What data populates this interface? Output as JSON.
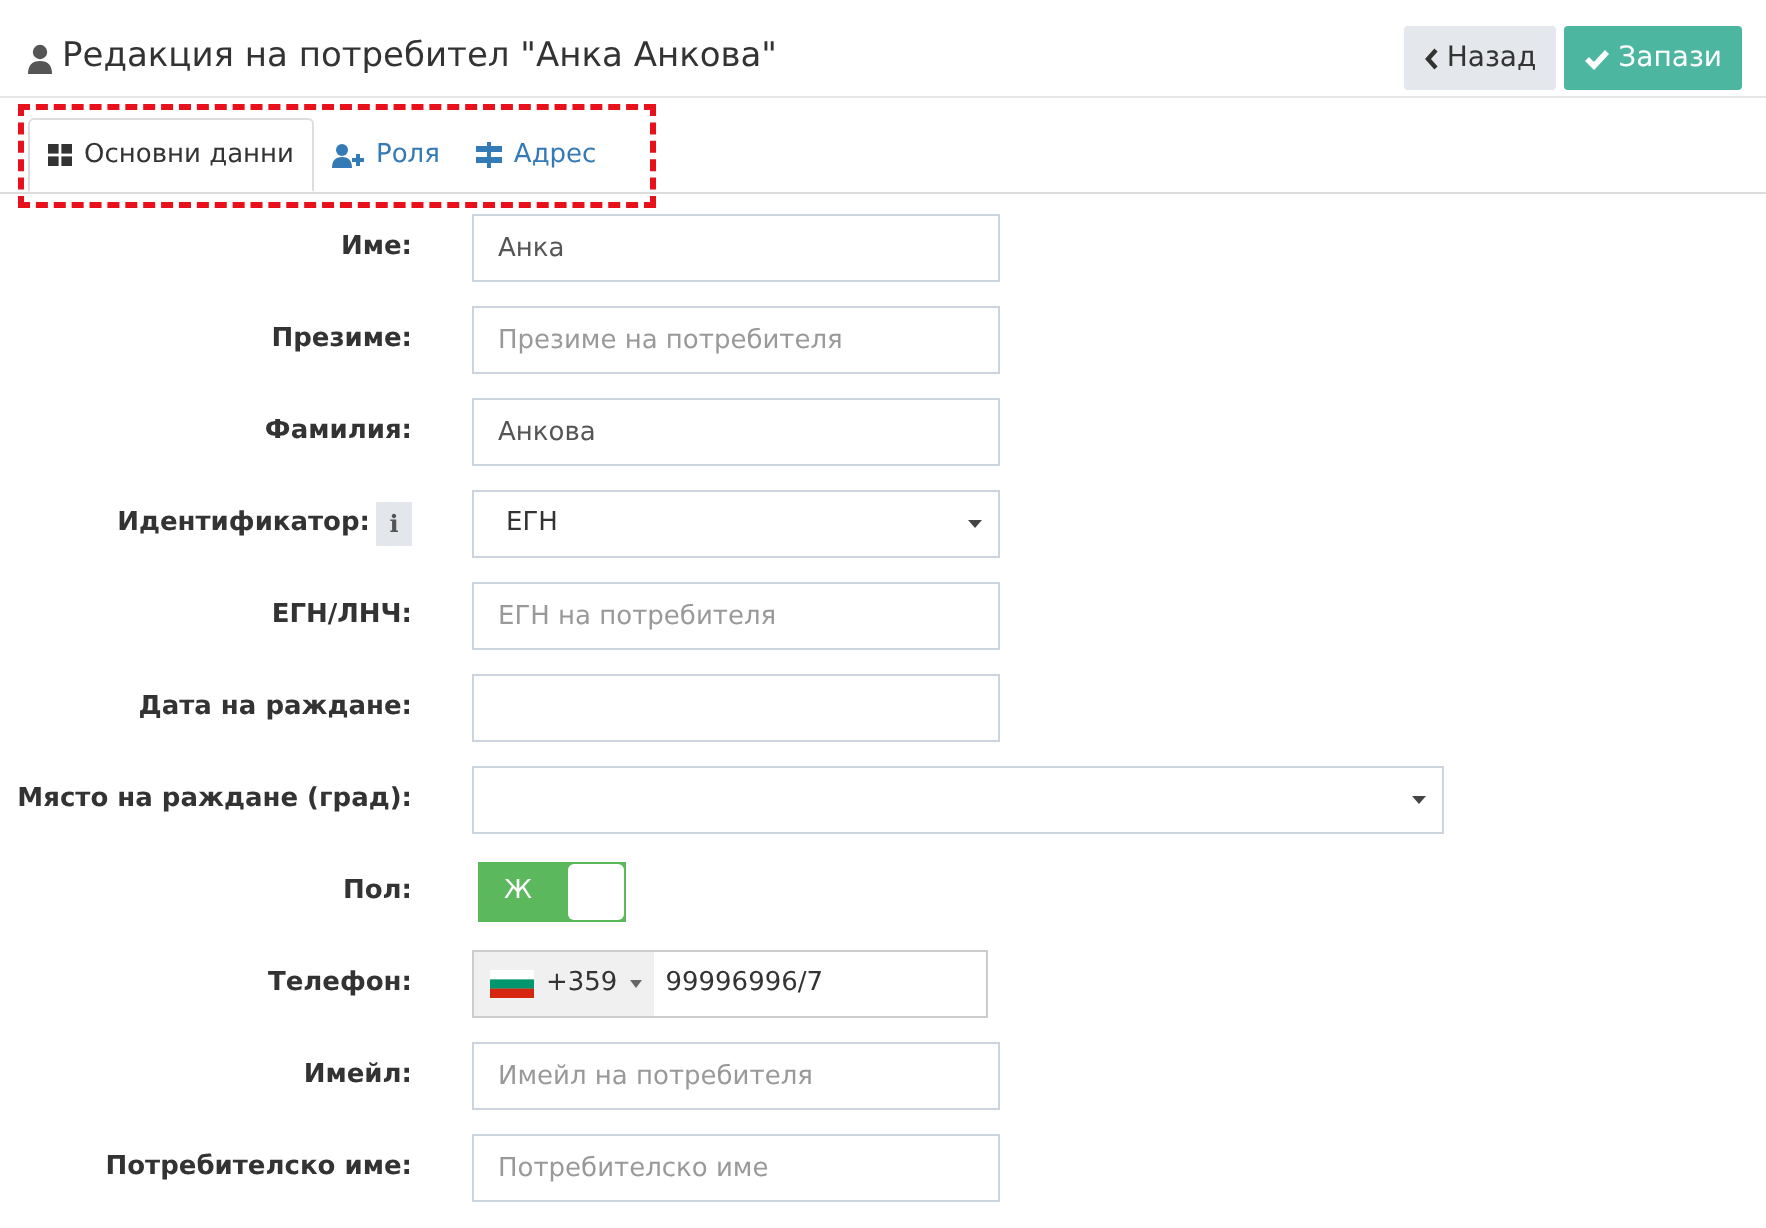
{
  "header": {
    "title": "Редакция на потребител \"Анка Анкова\"",
    "buttons": [
      {
        "label": "Назад",
        "kind": "back"
      },
      {
        "label": "Запази",
        "kind": "save"
      }
    ]
  },
  "tabs": [
    {
      "label": "Основни данни",
      "kind": "grid",
      "selected": true
    },
    {
      "label": "Роля",
      "kind": "user-plus",
      "selected": false
    },
    {
      "label": "Адрес",
      "kind": "signpost",
      "selected": false
    }
  ],
  "highlighted": true,
  "fields": [
    {
      "kind": "text",
      "label": "Име:",
      "value": "Анка"
    },
    {
      "kind": "text",
      "label": "Презиме:",
      "placeholder": "Презиме на потребителя"
    },
    {
      "kind": "text",
      "label": "Фамилия:",
      "value": "Анкова"
    },
    {
      "kind": "select",
      "label": "Идентификатор:",
      "info": "i",
      "value": "ЕГН"
    },
    {
      "kind": "text",
      "label": "ЕГН/ЛНЧ:",
      "placeholder": "ЕГН на потребителя"
    },
    {
      "kind": "text",
      "label": "Дата на раждане:"
    },
    {
      "kind": "select",
      "label": "Място на раждане (град):",
      "wide": true
    },
    {
      "kind": "toggle",
      "label": "Пол:",
      "on": true,
      "value": "Ж"
    },
    {
      "kind": "phone",
      "label": "Телефон:",
      "code": "+359",
      "value": "99996996/7"
    },
    {
      "kind": "text",
      "label": "Имейл:",
      "placeholder": "Имейл на потребителя"
    },
    {
      "kind": "text",
      "label": "Потребителско име:",
      "placeholder": "Потребителско име"
    }
  ]
}
